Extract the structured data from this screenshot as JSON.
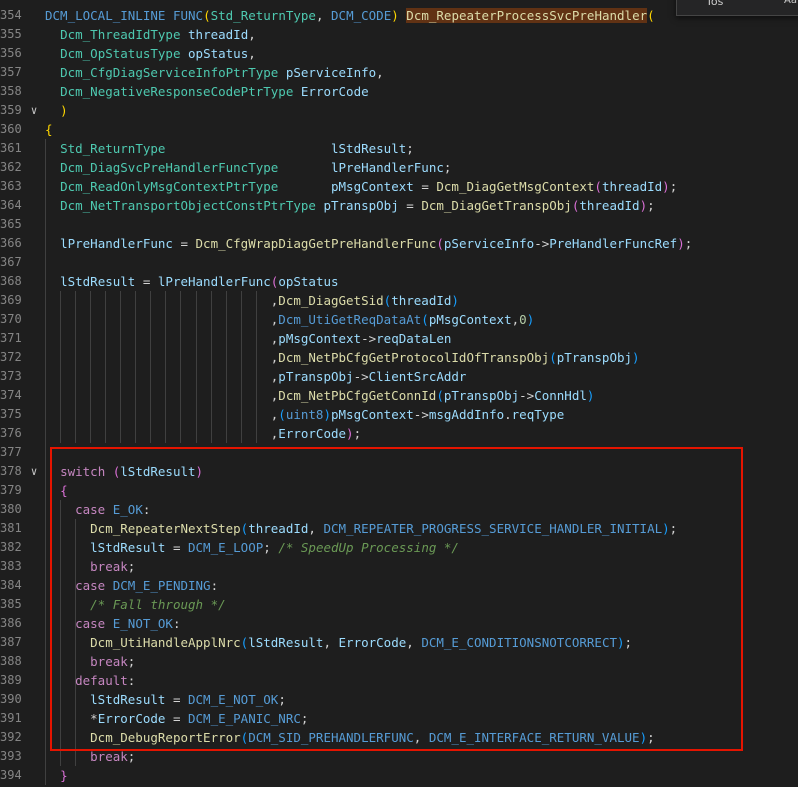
{
  "colors": {
    "background": "#1e1e1e",
    "keyword": "#569cd6",
    "control": "#c586c0",
    "type": "#4ec9b0",
    "function": "#dcdcaa",
    "variable": "#9cdcfe",
    "number": "#b5cea8",
    "comment": "#6a9955",
    "highlight_border": "#e51400"
  },
  "find_widget": {
    "input_value": "Tos",
    "match_case_label": "Aa"
  },
  "lines": [
    {
      "n": "354",
      "fold": "",
      "tokens": [
        [
          "DCM_LOCAL_INLINE",
          "kw"
        ],
        [
          " ",
          "p"
        ],
        [
          "FUNC",
          "kw"
        ],
        [
          "(",
          "br1"
        ],
        [
          "Std_ReturnType",
          "type"
        ],
        [
          ", ",
          "p"
        ],
        [
          "DCM_CODE",
          "kw"
        ],
        [
          ") ",
          "br1"
        ],
        [
          "Dcm_RepeaterProcessSvcPreHandler",
          "hl"
        ],
        [
          "(",
          "br1"
        ]
      ]
    },
    {
      "n": "355",
      "fold": "",
      "tokens": [
        [
          "  ",
          "p"
        ],
        [
          "Dcm_ThreadIdType",
          "type"
        ],
        [
          " ",
          "p"
        ],
        [
          "threadId",
          "var"
        ],
        [
          ",",
          "p"
        ]
      ]
    },
    {
      "n": "356",
      "fold": "",
      "tokens": [
        [
          "  ",
          "p"
        ],
        [
          "Dcm_OpStatusType",
          "type"
        ],
        [
          " ",
          "p"
        ],
        [
          "opStatus",
          "var"
        ],
        [
          ",",
          "p"
        ]
      ]
    },
    {
      "n": "357",
      "fold": "",
      "tokens": [
        [
          "  ",
          "p"
        ],
        [
          "Dcm_CfgDiagServiceInfoPtrType",
          "type"
        ],
        [
          " ",
          "p"
        ],
        [
          "pServiceInfo",
          "var"
        ],
        [
          ",",
          "p"
        ]
      ]
    },
    {
      "n": "358",
      "fold": "",
      "tokens": [
        [
          "  ",
          "p"
        ],
        [
          "Dcm_NegativeResponseCodePtrType",
          "type"
        ],
        [
          " ",
          "p"
        ],
        [
          "ErrorCode",
          "var"
        ]
      ]
    },
    {
      "n": "359",
      "fold": "∨",
      "tokens": [
        [
          "  ",
          "p"
        ],
        [
          ")",
          "br1"
        ]
      ]
    },
    {
      "n": "360",
      "fold": "",
      "tokens": [
        [
          "{",
          "br1"
        ]
      ]
    },
    {
      "n": "361",
      "fold": "",
      "tokens": [
        [
          "  ",
          "p"
        ],
        [
          "Std_ReturnType",
          "type"
        ],
        [
          "                      ",
          "p"
        ],
        [
          "lStdResult",
          "var"
        ],
        [
          ";",
          "p"
        ]
      ]
    },
    {
      "n": "362",
      "fold": "",
      "tokens": [
        [
          "  ",
          "p"
        ],
        [
          "Dcm_DiagSvcPreHandlerFuncType",
          "type"
        ],
        [
          "       ",
          "p"
        ],
        [
          "lPreHandlerFunc",
          "var"
        ],
        [
          ";",
          "p"
        ]
      ]
    },
    {
      "n": "363",
      "fold": "",
      "tokens": [
        [
          "  ",
          "p"
        ],
        [
          "Dcm_ReadOnlyMsgContextPtrType",
          "type"
        ],
        [
          "       ",
          "p"
        ],
        [
          "pMsgContext",
          "var"
        ],
        [
          " = ",
          "p"
        ],
        [
          "Dcm_DiagGetMsgContext",
          "fn"
        ],
        [
          "(",
          "br2"
        ],
        [
          "threadId",
          "var"
        ],
        [
          ")",
          "br2"
        ],
        [
          ";",
          "p"
        ]
      ]
    },
    {
      "n": "364",
      "fold": "",
      "tokens": [
        [
          "  ",
          "p"
        ],
        [
          "Dcm_NetTransportObjectConstPtrType",
          "type"
        ],
        [
          " ",
          "p"
        ],
        [
          "pTranspObj",
          "var"
        ],
        [
          " = ",
          "p"
        ],
        [
          "Dcm_DiagGetTranspObj",
          "fn"
        ],
        [
          "(",
          "br2"
        ],
        [
          "threadId",
          "var"
        ],
        [
          ")",
          "br2"
        ],
        [
          ";",
          "p"
        ]
      ]
    },
    {
      "n": "365",
      "fold": "",
      "tokens": []
    },
    {
      "n": "366",
      "fold": "",
      "tokens": [
        [
          "  ",
          "p"
        ],
        [
          "lPreHandlerFunc",
          "var"
        ],
        [
          " = ",
          "p"
        ],
        [
          "Dcm_CfgWrapDiagGetPreHandlerFunc",
          "fn"
        ],
        [
          "(",
          "br2"
        ],
        [
          "pServiceInfo",
          "var"
        ],
        [
          "->",
          "p"
        ],
        [
          "PreHandlerFuncRef",
          "var"
        ],
        [
          ")",
          "br2"
        ],
        [
          ";",
          "p"
        ]
      ]
    },
    {
      "n": "367",
      "fold": "",
      "tokens": []
    },
    {
      "n": "368",
      "fold": "",
      "tokens": [
        [
          "  ",
          "p"
        ],
        [
          "lStdResult",
          "var"
        ],
        [
          " = ",
          "p"
        ],
        [
          "lPreHandlerFunc",
          "var"
        ],
        [
          "(",
          "br2"
        ],
        [
          "opStatus",
          "var"
        ]
      ]
    },
    {
      "n": "369",
      "fold": "",
      "tokens": [
        [
          "                              ,",
          "p"
        ],
        [
          "Dcm_DiagGetSid",
          "fn"
        ],
        [
          "(",
          "br3"
        ],
        [
          "threadId",
          "var"
        ],
        [
          ")",
          "br3"
        ]
      ]
    },
    {
      "n": "370",
      "fold": "",
      "tokens": [
        [
          "                              ,",
          "p"
        ],
        [
          "Dcm_UtiGetReqDataAt",
          "mac"
        ],
        [
          "(",
          "br3"
        ],
        [
          "pMsgContext",
          "var"
        ],
        [
          ",",
          "p"
        ],
        [
          "0",
          "num"
        ],
        [
          ")",
          "br3"
        ]
      ]
    },
    {
      "n": "371",
      "fold": "",
      "tokens": [
        [
          "                              ,",
          "p"
        ],
        [
          "pMsgContext",
          "var"
        ],
        [
          "->",
          "p"
        ],
        [
          "reqDataLen",
          "var"
        ]
      ]
    },
    {
      "n": "372",
      "fold": "",
      "tokens": [
        [
          "                              ,",
          "p"
        ],
        [
          "Dcm_NetPbCfgGetProtocolIdOfTranspObj",
          "fn"
        ],
        [
          "(",
          "br3"
        ],
        [
          "pTranspObj",
          "var"
        ],
        [
          ")",
          "br3"
        ]
      ]
    },
    {
      "n": "373",
      "fold": "",
      "tokens": [
        [
          "                              ,",
          "p"
        ],
        [
          "pTranspObj",
          "var"
        ],
        [
          "->",
          "p"
        ],
        [
          "ClientSrcAddr",
          "var"
        ]
      ]
    },
    {
      "n": "374",
      "fold": "",
      "tokens": [
        [
          "                              ,",
          "p"
        ],
        [
          "Dcm_NetPbCfgGetConnId",
          "fn"
        ],
        [
          "(",
          "br3"
        ],
        [
          "pTranspObj",
          "var"
        ],
        [
          "->",
          "p"
        ],
        [
          "ConnHdl",
          "var"
        ],
        [
          ")",
          "br3"
        ]
      ]
    },
    {
      "n": "375",
      "fold": "",
      "tokens": [
        [
          "                              ,",
          "p"
        ],
        [
          "(",
          "br3"
        ],
        [
          "uint8",
          "kw"
        ],
        [
          ")",
          "br3"
        ],
        [
          "pMsgContext",
          "var"
        ],
        [
          "->",
          "p"
        ],
        [
          "msgAddInfo",
          "var"
        ],
        [
          ".",
          "p"
        ],
        [
          "reqType",
          "var"
        ]
      ]
    },
    {
      "n": "376",
      "fold": "",
      "tokens": [
        [
          "                              ,",
          "p"
        ],
        [
          "ErrorCode",
          "var"
        ],
        [
          ")",
          "br2"
        ],
        [
          ";",
          "p"
        ]
      ]
    },
    {
      "n": "377",
      "fold": "",
      "tokens": []
    },
    {
      "n": "378",
      "fold": "∨",
      "tokens": [
        [
          "  ",
          "p"
        ],
        [
          "switch",
          "ctrl"
        ],
        [
          " ",
          "p"
        ],
        [
          "(",
          "br2"
        ],
        [
          "lStdResult",
          "var"
        ],
        [
          ")",
          "br2"
        ]
      ]
    },
    {
      "n": "379",
      "fold": "",
      "tokens": [
        [
          "  ",
          "p"
        ],
        [
          "{",
          "br2"
        ]
      ]
    },
    {
      "n": "380",
      "fold": "",
      "tokens": [
        [
          "    ",
          "p"
        ],
        [
          "case",
          "ctrl"
        ],
        [
          " ",
          "p"
        ],
        [
          "E_OK",
          "mac"
        ],
        [
          ":",
          "p"
        ]
      ]
    },
    {
      "n": "381",
      "fold": "",
      "tokens": [
        [
          "      ",
          "p"
        ],
        [
          "Dcm_RepeaterNextStep",
          "fn"
        ],
        [
          "(",
          "br3"
        ],
        [
          "threadId",
          "var"
        ],
        [
          ", ",
          "p"
        ],
        [
          "DCM_REPEATER_PROGRESS_SERVICE_HANDLER_INITIAL",
          "mac"
        ],
        [
          ")",
          "br3"
        ],
        [
          ";",
          "p"
        ]
      ]
    },
    {
      "n": "382",
      "fold": "",
      "tokens": [
        [
          "      ",
          "p"
        ],
        [
          "lStdResult",
          "var"
        ],
        [
          " = ",
          "p"
        ],
        [
          "DCM_E_LOOP",
          "mac"
        ],
        [
          "; ",
          "p"
        ],
        [
          "/* SpeedUp Processing */",
          "com"
        ]
      ]
    },
    {
      "n": "383",
      "fold": "",
      "tokens": [
        [
          "      ",
          "p"
        ],
        [
          "break",
          "ctrl"
        ],
        [
          ";",
          "p"
        ]
      ]
    },
    {
      "n": "384",
      "fold": "",
      "tokens": [
        [
          "    ",
          "p"
        ],
        [
          "case",
          "ctrl"
        ],
        [
          " ",
          "p"
        ],
        [
          "DCM_E_PENDING",
          "mac"
        ],
        [
          ":",
          "p"
        ]
      ]
    },
    {
      "n": "385",
      "fold": "",
      "tokens": [
        [
          "      ",
          "p"
        ],
        [
          "/* Fall through */",
          "com"
        ]
      ]
    },
    {
      "n": "386",
      "fold": "",
      "tokens": [
        [
          "    ",
          "p"
        ],
        [
          "case",
          "ctrl"
        ],
        [
          " ",
          "p"
        ],
        [
          "E_NOT_OK",
          "mac"
        ],
        [
          ":",
          "p"
        ]
      ]
    },
    {
      "n": "387",
      "fold": "",
      "tokens": [
        [
          "      ",
          "p"
        ],
        [
          "Dcm_UtiHandleApplNrc",
          "fn"
        ],
        [
          "(",
          "br3"
        ],
        [
          "lStdResult",
          "var"
        ],
        [
          ", ",
          "p"
        ],
        [
          "ErrorCode",
          "var"
        ],
        [
          ", ",
          "p"
        ],
        [
          "DCM_E_CONDITIONSNOTCORRECT",
          "mac"
        ],
        [
          ")",
          "br3"
        ],
        [
          ";",
          "p"
        ]
      ]
    },
    {
      "n": "388",
      "fold": "",
      "tokens": [
        [
          "      ",
          "p"
        ],
        [
          "break",
          "ctrl"
        ],
        [
          ";",
          "p"
        ]
      ]
    },
    {
      "n": "389",
      "fold": "",
      "tokens": [
        [
          "    ",
          "p"
        ],
        [
          "default",
          "ctrl"
        ],
        [
          ":",
          "p"
        ]
      ]
    },
    {
      "n": "390",
      "fold": "",
      "tokens": [
        [
          "      ",
          "p"
        ],
        [
          "lStdResult",
          "var"
        ],
        [
          " = ",
          "p"
        ],
        [
          "DCM_E_NOT_OK",
          "mac"
        ],
        [
          ";",
          "p"
        ]
      ]
    },
    {
      "n": "391",
      "fold": "",
      "tokens": [
        [
          "      ",
          "p"
        ],
        [
          "*",
          "p"
        ],
        [
          "ErrorCode",
          "var"
        ],
        [
          " = ",
          "p"
        ],
        [
          "DCM_E_PANIC_NRC",
          "mac"
        ],
        [
          ";",
          "p"
        ]
      ]
    },
    {
      "n": "392",
      "fold": "",
      "tokens": [
        [
          "      ",
          "p"
        ],
        [
          "Dcm_DebugReportError",
          "fn"
        ],
        [
          "(",
          "br3"
        ],
        [
          "DCM_SID_PREHANDLERFUNC",
          "mac"
        ],
        [
          ", ",
          "p"
        ],
        [
          "DCM_E_INTERFACE_RETURN_VALUE",
          "mac"
        ],
        [
          ")",
          "br3"
        ],
        [
          ";",
          "p"
        ]
      ]
    },
    {
      "n": "393",
      "fold": "",
      "tokens": [
        [
          "      ",
          "p"
        ],
        [
          "break",
          "ctrl"
        ],
        [
          ";",
          "p"
        ]
      ]
    },
    {
      "n": "394",
      "fold": "",
      "tokens": [
        [
          "  ",
          "p"
        ],
        [
          "}",
          "br2"
        ]
      ]
    }
  ]
}
